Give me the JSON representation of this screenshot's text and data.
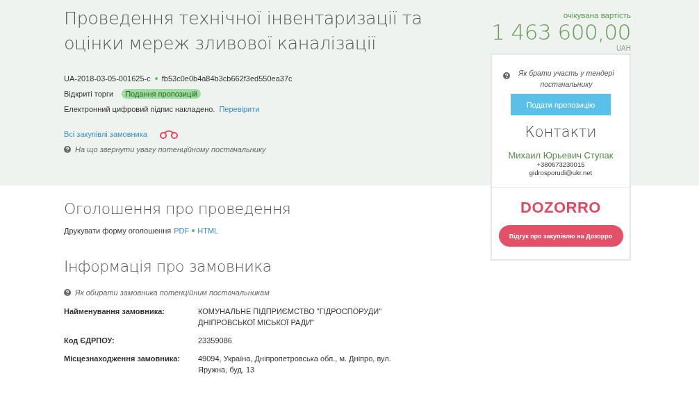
{
  "title": "Проведення технічної інвентаризації та оцінки мереж зливової каналізації",
  "tender_id": "UA-2018-03-05-001625-c",
  "hash": "fb53c0e0b4a84b3cb662f3ed550ea37c",
  "procedure": "Відкриті торги",
  "status": "Подання пропозицій",
  "signature": {
    "text": "Електронний цифровий підпис накладено.",
    "link": "Перевірити"
  },
  "all_purchases_link": "Всі закупівлі замовника",
  "hint_top": "На що звернути увагу потенційному постачальнику",
  "price": {
    "label": "очікувана вартість",
    "amount": "1 463 600,00",
    "currency": "UAH"
  },
  "card": {
    "hint": "Як брати участь у тендері постачальнику",
    "submit_button": "Подати пропозицію",
    "contacts_title": "Контакти",
    "contact_name": "Михаил Юрьевич Ступак",
    "phone": "+380673230015",
    "email": "gidrosporudi@ukr.net",
    "logo": "DOZORRO",
    "feedback_button": "Відгук про закупівлю на Дозорро"
  },
  "announcement": {
    "title": "Оголошення про проведення",
    "print_label": "Друкувати форму оголошення",
    "formats": [
      "PDF",
      "HTML"
    ]
  },
  "customer": {
    "title": "Інформація про замовника",
    "hint": "Як обирати замовника потенційним постачальникам",
    "rows": [
      {
        "label": "Найменування замовника:",
        "value": "КОМУНАЛЬНЕ ПІДПРИЄМСТВО \"ГІДРОСПОРУДИ\" ДНІПРОВСЬКОЇ МІСЬКОЇ РАДИ\""
      },
      {
        "label": "Код ЄДРПОУ:",
        "value": "23359086"
      },
      {
        "label": "Місцезнаходження замовника:",
        "value": "49094, Україна, Дніпропетровська обл., м. Дніпро, вул. Яружна, буд. 13"
      }
    ]
  }
}
